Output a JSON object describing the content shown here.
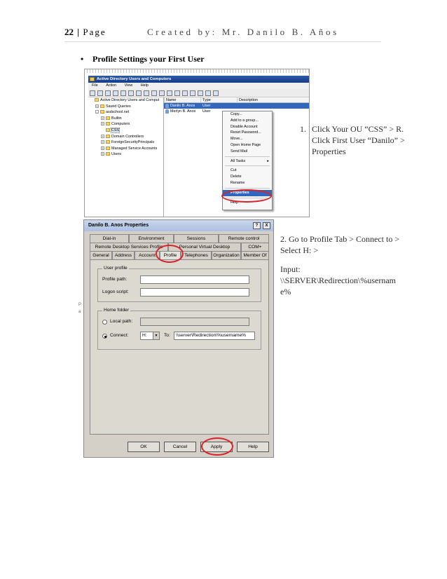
{
  "header": {
    "page_number": "22",
    "separator": "|",
    "page_label": "Page",
    "credit": "Created by: Mr. Danilo B. Años"
  },
  "bullet": {
    "glyph": "•",
    "text": "Profile Settings your First User"
  },
  "aduc": {
    "title": "Active Directory Users and Computers",
    "menu": [
      "File",
      "Action",
      "View",
      "Help"
    ],
    "tree": [
      {
        "label": "Active Directory Users and Comput",
        "indent": 0,
        "expander": ""
      },
      {
        "label": "Saved Queries",
        "indent": 1,
        "expander": "+"
      },
      {
        "label": "asdschool.net",
        "indent": 1,
        "expander": "-"
      },
      {
        "label": "Builtin",
        "indent": 2,
        "expander": "+"
      },
      {
        "label": "Computers",
        "indent": 2,
        "expander": "+"
      },
      {
        "label": "CSS",
        "indent": 2,
        "expander": "",
        "selected": true
      },
      {
        "label": "Domain Controllers",
        "indent": 2,
        "expander": "+"
      },
      {
        "label": "ForeignSecurityPrincipals",
        "indent": 2,
        "expander": "+"
      },
      {
        "label": "Managed Service Accounts",
        "indent": 2,
        "expander": "+"
      },
      {
        "label": "Users",
        "indent": 2,
        "expander": "+"
      }
    ],
    "columns": [
      "Name",
      "Type",
      "Description"
    ],
    "rows": [
      {
        "name": "Danilo B. Anos",
        "type": "User",
        "selected": true
      },
      {
        "name": "Merlyn B. Anos",
        "type": "User",
        "selected": false
      }
    ],
    "context_menu": [
      {
        "label": "Copy...",
        "style": "normal"
      },
      {
        "label": "Add to a group...",
        "style": "normal"
      },
      {
        "label": "Disable Account",
        "style": "normal"
      },
      {
        "label": "Reset Password...",
        "style": "normal"
      },
      {
        "label": "Move...",
        "style": "normal"
      },
      {
        "label": "Open Home Page",
        "style": "normal"
      },
      {
        "label": "Send Mail",
        "style": "normal"
      },
      {
        "label": "",
        "style": "separator"
      },
      {
        "label": "All Tasks",
        "style": "submenu"
      },
      {
        "label": "",
        "style": "separator"
      },
      {
        "label": "Cut",
        "style": "normal"
      },
      {
        "label": "Delete",
        "style": "normal"
      },
      {
        "label": "Rename",
        "style": "normal"
      },
      {
        "label": "",
        "style": "separator"
      },
      {
        "label": "Properties",
        "style": "highlight"
      },
      {
        "label": "",
        "style": "separator"
      },
      {
        "label": "Help",
        "style": "normal"
      }
    ],
    "submenu_arrow": "▸"
  },
  "step1": {
    "number": "1.",
    "text": "Click Your OU “CSS” > R. Click First User “Danilo” > Properties"
  },
  "step2": {
    "text": "2. Go to Profile Tab > Connect to > Select H: >"
  },
  "step3": {
    "label": "Input:",
    "value": "\\\\SERVER\\Redirection\\%username%"
  },
  "dialog": {
    "title": "Danilo B. Anos Properties",
    "help_btn": "?",
    "close_btn": "X",
    "tabs_row1": [
      "Dial-in",
      "Environment",
      "Sessions",
      "Remote control"
    ],
    "tabs_row2": [
      "Remote Desktop Services Profile",
      "Personal Virtual Desktop",
      "COM+"
    ],
    "tabs_row3": [
      "General",
      "Address",
      "Account",
      "Profile",
      "Telephones",
      "Organization",
      "Member Of"
    ],
    "user_profile_legend": "User profile",
    "profile_path_label": "Profile path:",
    "profile_path_value": "",
    "logon_script_label": "Logon script:",
    "logon_script_value": "",
    "home_folder_legend": "Home folder",
    "local_path_label": "Local path:",
    "connect_label": "Connect:",
    "drive": "H:",
    "dropdown_glyph": "▼",
    "to_label": "To:",
    "connect_path": "\\\\server\\Redirection\\%username%",
    "buttons": [
      "OK",
      "Cancel",
      "Apply",
      "Help"
    ]
  },
  "margin_marks": [
    "P",
    "a"
  ],
  "accent_red": "#d9232a",
  "selection_blue": "#3267c0"
}
